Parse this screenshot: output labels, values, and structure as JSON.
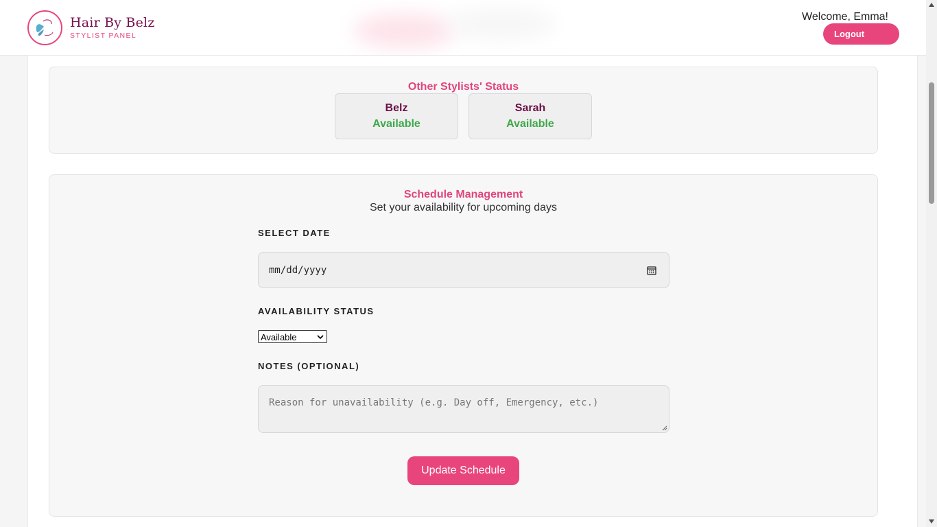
{
  "header": {
    "brand_title": "Hair By Belz",
    "brand_subtitle": "STYLIST PANEL",
    "welcome": "Welcome, Emma!",
    "logout_label": "Logout"
  },
  "status_section": {
    "title": "Other Stylists' Status",
    "stylists": [
      {
        "name": "Belz",
        "status": "Available"
      },
      {
        "name": "Sarah",
        "status": "Available"
      }
    ]
  },
  "schedule": {
    "title": "Schedule Management",
    "subtitle": "Set your availability for upcoming days",
    "date_label": "SELECT DATE",
    "date_placeholder": "mm/dd/yyyy",
    "availability_label": "AVAILABILITY STATUS",
    "availability_selected": "Available",
    "notes_label": "NOTES (OPTIONAL)",
    "notes_placeholder": "Reason for unavailability (e.g. Day off, Emergency, etc.)",
    "update_label": "Update Schedule"
  },
  "icons": {
    "logo": "butterfly-logo-icon",
    "calendar": "calendar-icon",
    "select_arrow": "chevron-down-icon"
  },
  "colors": {
    "accent": "#e8457d",
    "brand": "#7a1050",
    "available": "#3fa84a"
  }
}
